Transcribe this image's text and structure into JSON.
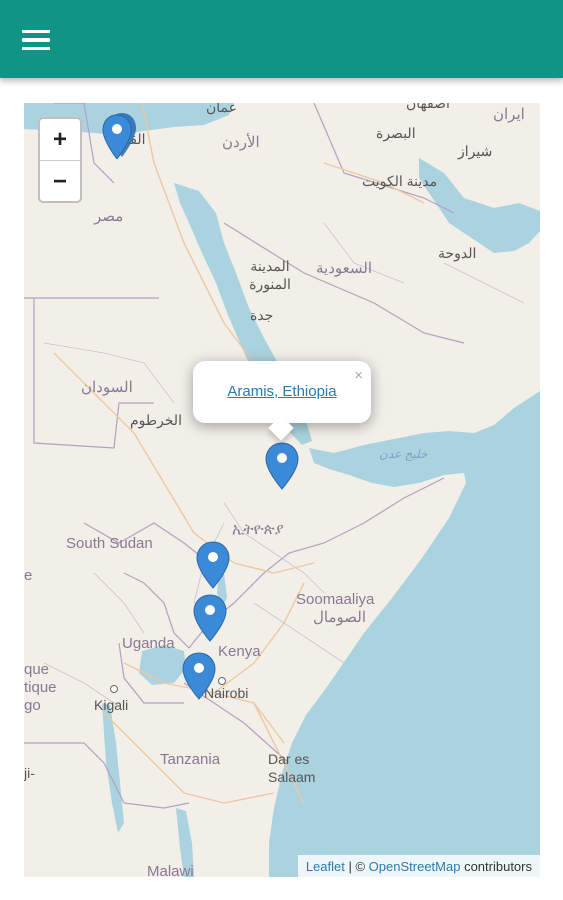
{
  "appbar": {
    "menu_icon": "hamburger-menu-icon",
    "color": "#0f9486"
  },
  "map": {
    "zoom_in": "+",
    "zoom_out": "−",
    "popup": {
      "link": "Aramis, Ethiopia",
      "close": "×"
    },
    "attribution": {
      "leaflet": "Leaflet",
      "sep": " | © ",
      "osm": "OpenStreetMap",
      "contributors": " contributors"
    },
    "labels": {
      "amman": "عمان",
      "jordan": "الأردن",
      "isfahan": "اصفهان",
      "iran": "ایران",
      "basra": "البصرة",
      "shiraz": "شیراز",
      "kuwait_city": "مدينة الكويت",
      "egypt": "مصر",
      "cairo": "القا",
      "madinah": "المدينة المنورة",
      "saudi": "السعودية",
      "jeddah": "جدة",
      "doha": "الدوحة",
      "sudan": "السودان",
      "khartoum": "الخرطوم",
      "gulf_aden": "خليج عدن",
      "ethiopia": "ኢትዮጵያ",
      "south_sudan": "South Sudan",
      "somalia": "Soomaaliya",
      "somalia_ar": "الصومال",
      "uganda": "Uganda",
      "kenya": "Kenya",
      "kigali": "Kigali",
      "nairobi": "Nairobi",
      "tanzania": "Tanzania",
      "dar": "Dar es",
      "salaam": "Salaam",
      "malawi": "Malawi",
      "que": "que",
      "tique": "tique",
      "go": "go",
      "edge_e": "e",
      "edge_ji": "ji-"
    }
  }
}
